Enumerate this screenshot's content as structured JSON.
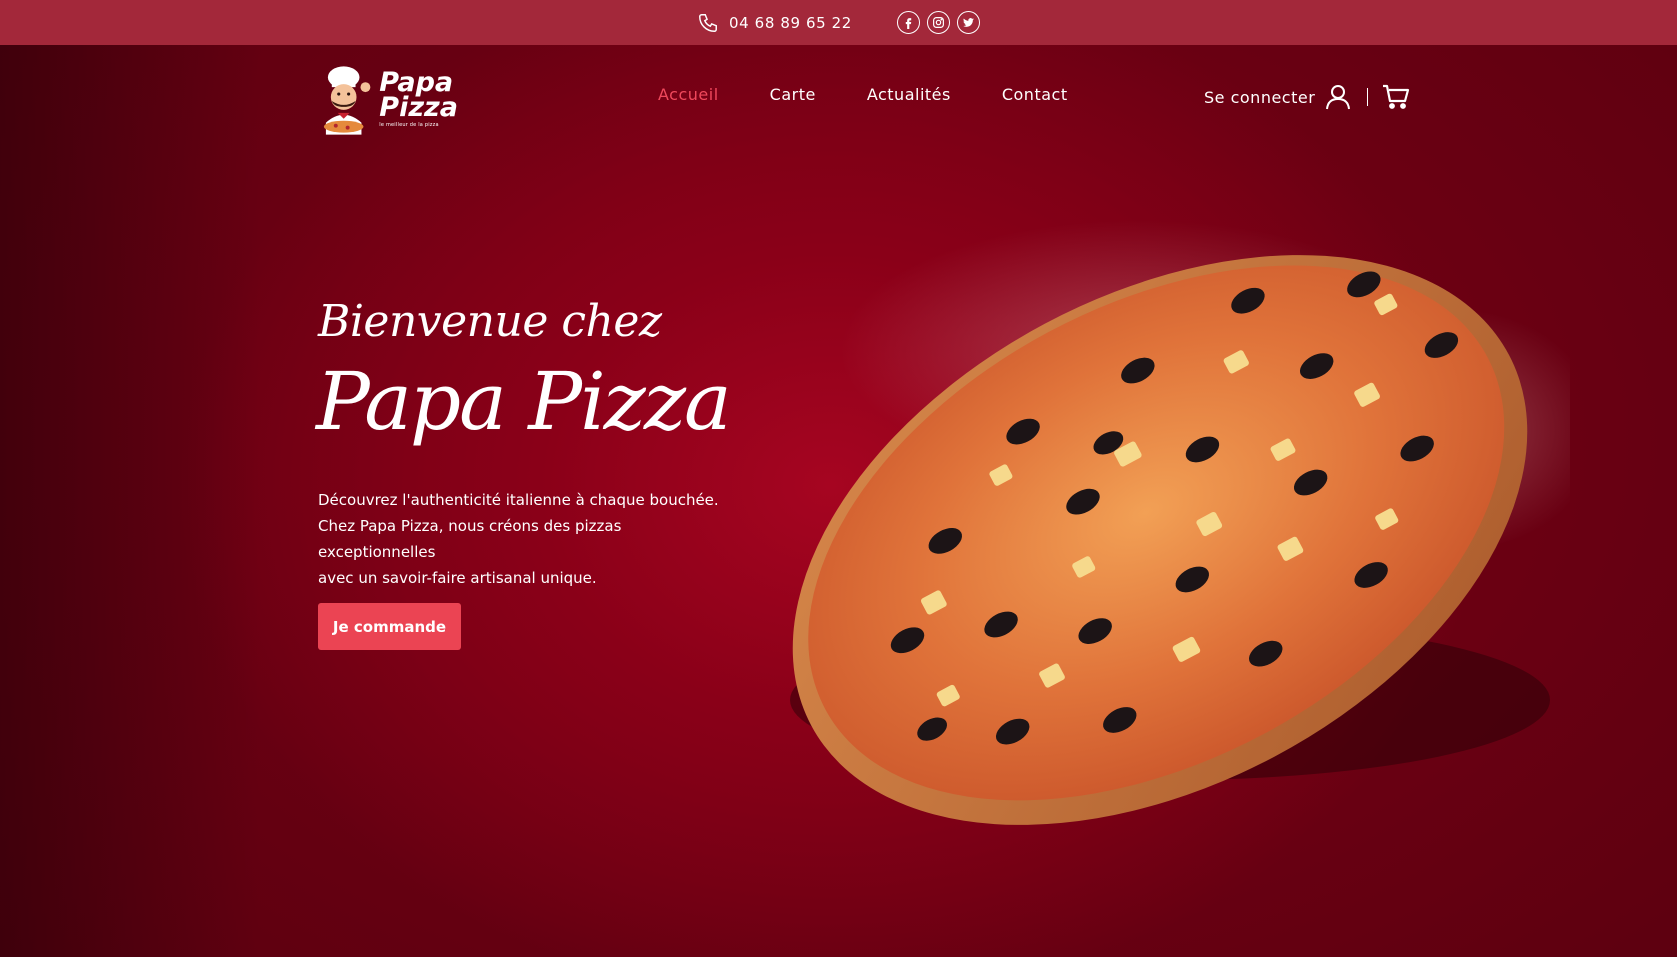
{
  "topbar": {
    "phone": "04 68 89 65 22",
    "socials": [
      "facebook-icon",
      "instagram-icon",
      "twitter-icon"
    ]
  },
  "header": {
    "logo": {
      "line1": "Papa",
      "line2": "Pizza",
      "tagline": "le meilleur de la pizza"
    },
    "nav": [
      {
        "label": "Accueil",
        "active": true
      },
      {
        "label": "Carte",
        "active": false
      },
      {
        "label": "Actualités",
        "active": false
      },
      {
        "label": "Contact",
        "active": false
      }
    ],
    "login_label": "Se connecter"
  },
  "hero": {
    "welcome": "Bienvenue chez",
    "brand": "Papa Pizza",
    "lead_lines": [
      "Découvrez l'authenticité italienne à chaque bouchée.",
      "Chez Papa Pizza, nous créons des pizzas exceptionnelles",
      "avec un savoir-faire artisanal unique."
    ],
    "cta_label": "Je commande"
  },
  "colors": {
    "topbar": "#a3283a",
    "accent": "#eb4453",
    "nav_active": "#f0485c",
    "background": "#8a0018"
  }
}
